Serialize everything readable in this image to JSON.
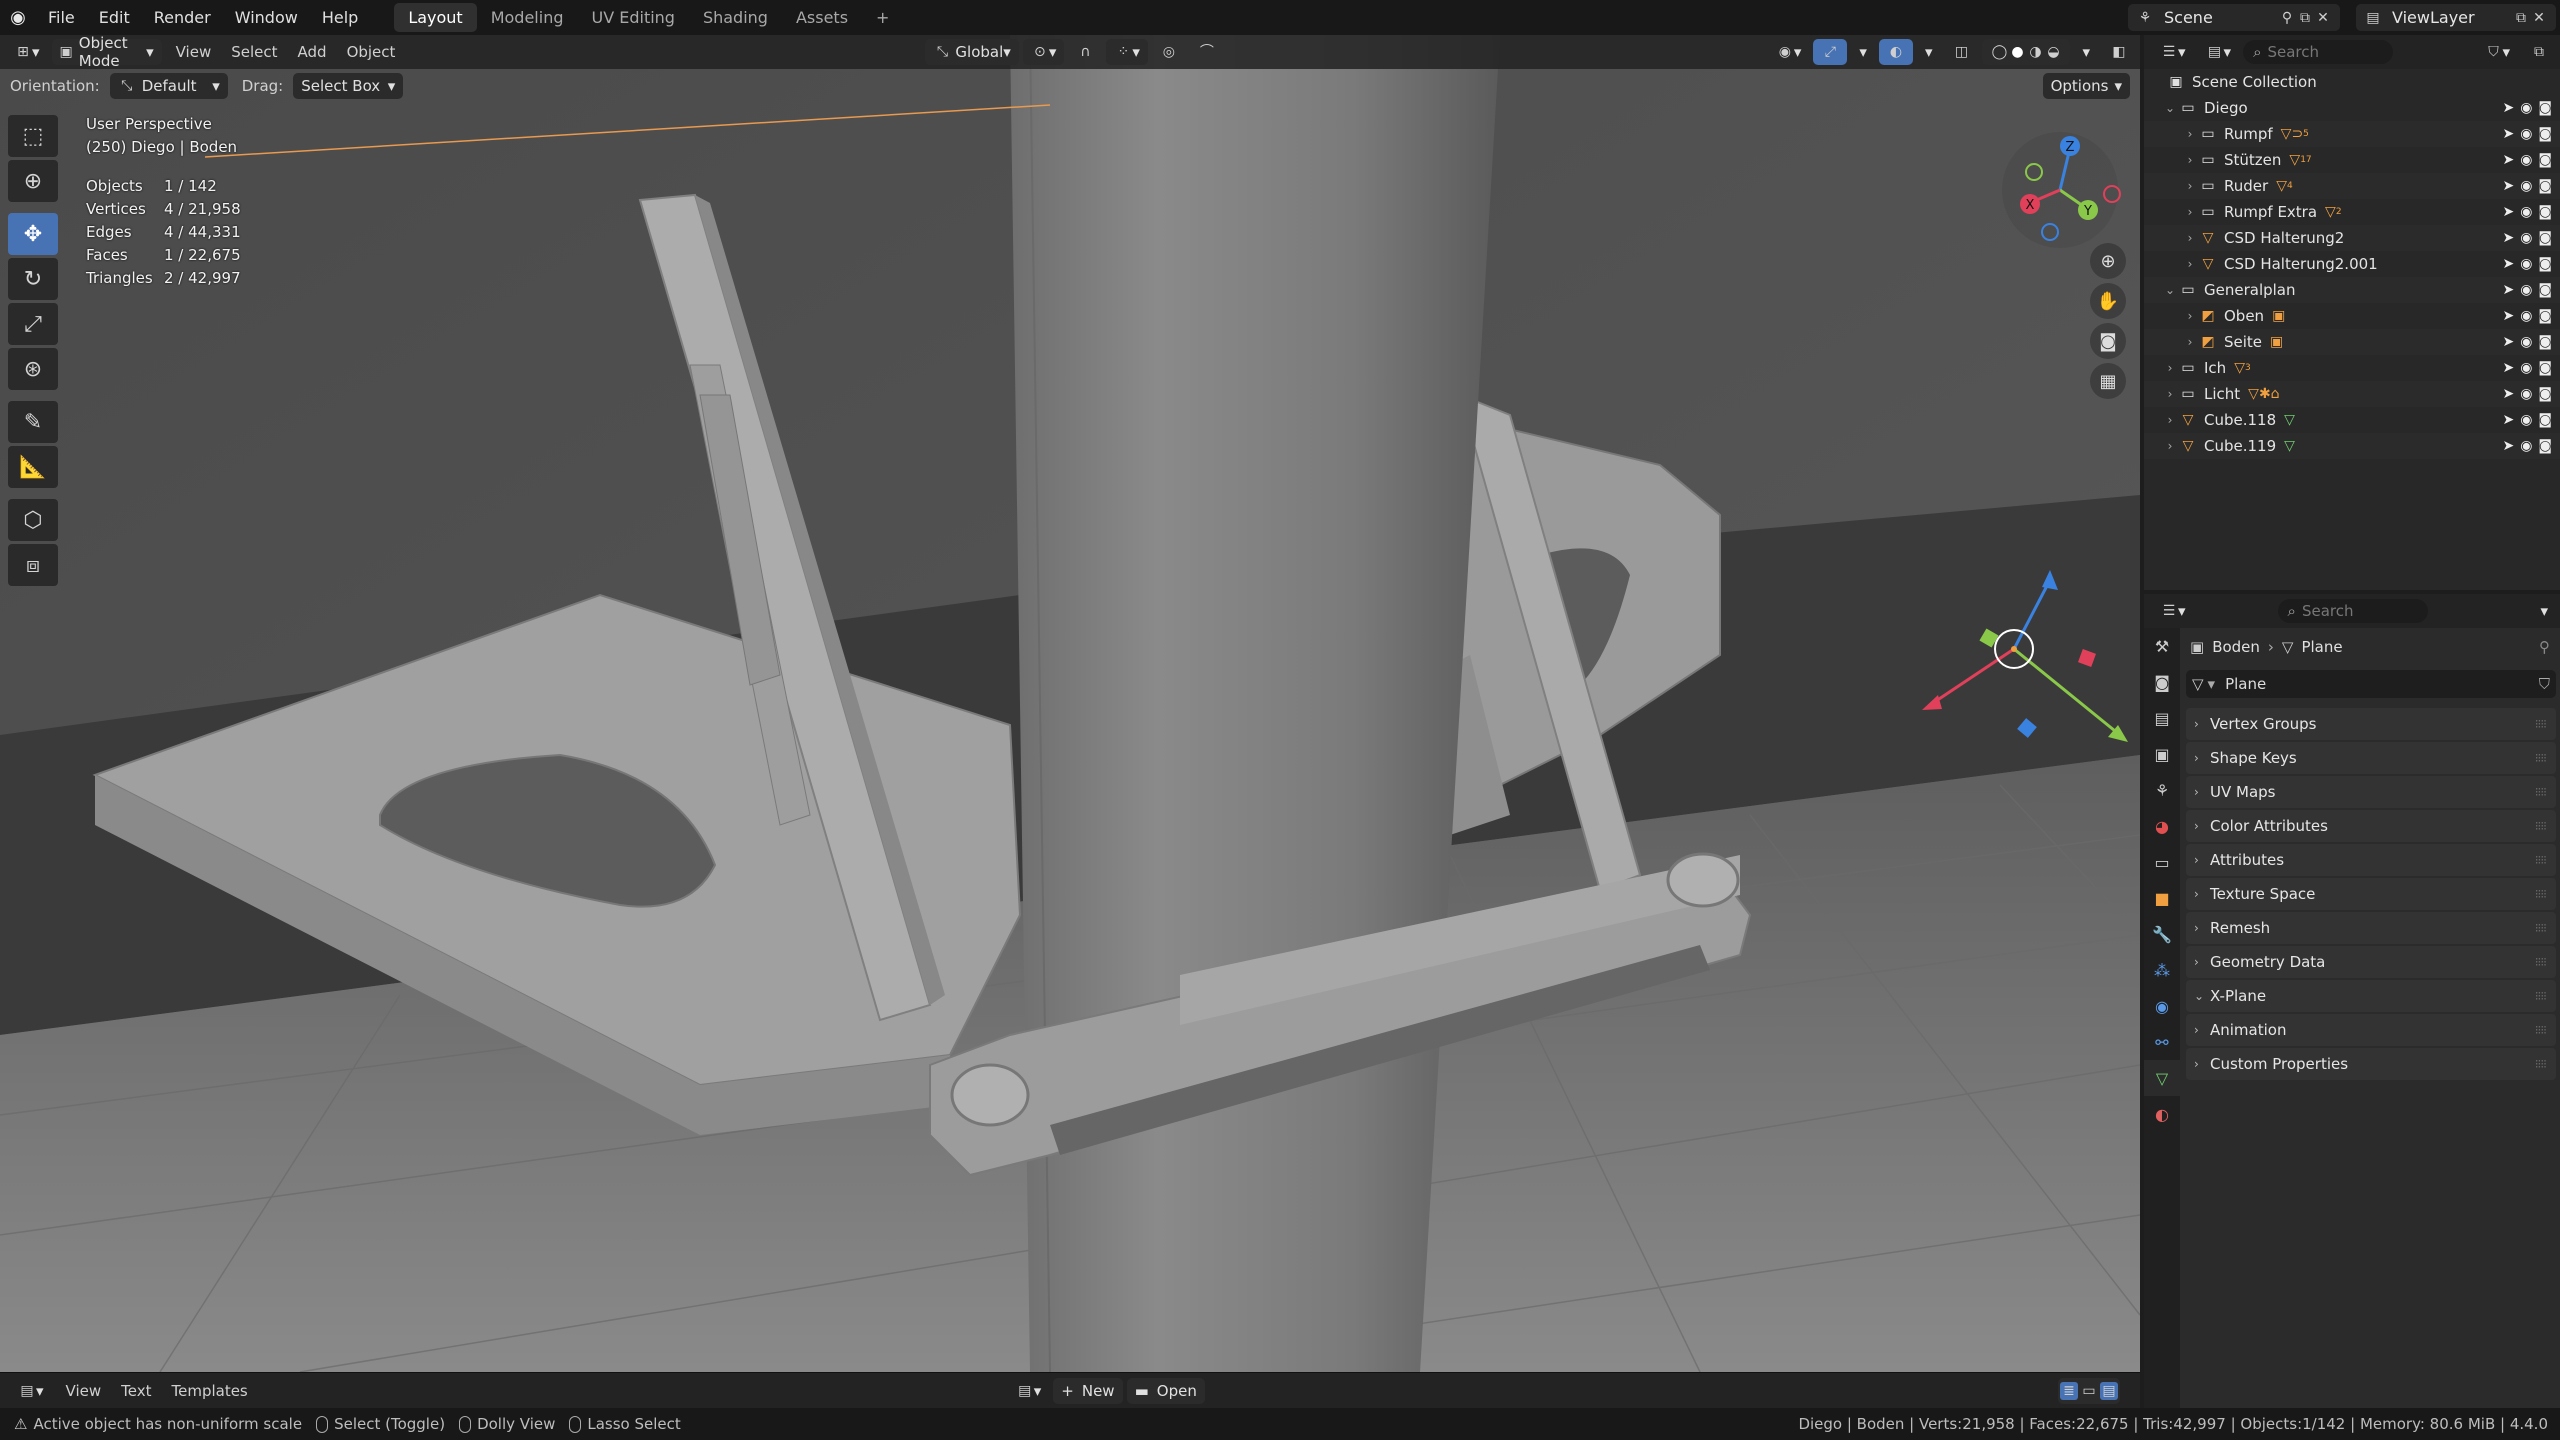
{
  "topbar": {
    "menus": [
      "File",
      "Edit",
      "Render",
      "Window",
      "Help"
    ],
    "workspaces": [
      "Layout",
      "Modeling",
      "UV Editing",
      "Shading",
      "Assets"
    ],
    "active_workspace": "Layout",
    "add_tab": "+",
    "scene_name": "Scene",
    "view_layer": "ViewLayer"
  },
  "viewport_header": {
    "mode": "Object Mode",
    "menus": [
      "View",
      "Select",
      "Add",
      "Object"
    ],
    "transform_orientation": "Global",
    "options_label": "Options",
    "orientation_label": "Orientation:",
    "orientation_value": "Default",
    "drag_label": "Drag:",
    "drag_value": "Select Box"
  },
  "overlay": {
    "view_name": "User Perspective",
    "context": "(250) Diego | Boden",
    "stats": [
      {
        "label": "Objects",
        "value": "1 / 142"
      },
      {
        "label": "Vertices",
        "value": "4 / 21,958"
      },
      {
        "label": "Edges",
        "value": "4 / 44,331"
      },
      {
        "label": "Faces",
        "value": "1 / 22,675"
      },
      {
        "label": "Triangles",
        "value": "2 / 42,997"
      }
    ]
  },
  "gizmo": {
    "x": "X",
    "y": "Y",
    "z": "Z"
  },
  "text_editor": {
    "menus": [
      "View",
      "Text",
      "Templates"
    ],
    "new_label": "New",
    "open_label": "Open"
  },
  "statusbar": {
    "warning": "Active object has non-uniform scale",
    "hint1": "Select (Toggle)",
    "hint2": "Dolly View",
    "hint3": "Lasso Select",
    "info": "Diego | Boden | Verts:21,958 | Faces:22,675 | Tris:42,997 | Objects:1/142 | Memory: 80.6 MiB | 4.4.0"
  },
  "outliner": {
    "search_placeholder": "Search",
    "root": "Scene Collection",
    "rows": [
      {
        "label": "Diego",
        "depth": 1,
        "type": "collection",
        "expanded": true,
        "badge": "",
        "badge_sub": ""
      },
      {
        "label": "Rumpf",
        "depth": 2,
        "type": "collection",
        "expanded": false,
        "badge": "▽⊃",
        "badge_sub": "5"
      },
      {
        "label": "Stützen",
        "depth": 2,
        "type": "collection",
        "expanded": false,
        "badge": "▽",
        "badge_sub": "17"
      },
      {
        "label": "Ruder",
        "depth": 2,
        "type": "collection",
        "expanded": false,
        "badge": "▽",
        "badge_sub": "4"
      },
      {
        "label": "Rumpf Extra",
        "depth": 2,
        "type": "collection",
        "expanded": false,
        "badge": "▽",
        "badge_sub": "2"
      },
      {
        "label": "CSD Halterung2",
        "depth": 2,
        "type": "mesh",
        "expanded": false,
        "badge": "",
        "badge_sub": ""
      },
      {
        "label": "CSD Halterung2.001",
        "depth": 2,
        "type": "mesh",
        "expanded": false,
        "badge": "",
        "badge_sub": ""
      },
      {
        "label": "Generalplan",
        "depth": 1,
        "type": "collection",
        "expanded": true,
        "badge": "",
        "badge_sub": ""
      },
      {
        "label": "Oben",
        "depth": 2,
        "type": "image",
        "expanded": false,
        "badge": "▣",
        "badge_sub": ""
      },
      {
        "label": "Seite",
        "depth": 2,
        "type": "image",
        "expanded": false,
        "badge": "▣",
        "badge_sub": ""
      },
      {
        "label": "Ich",
        "depth": 1,
        "type": "collection",
        "expanded": false,
        "badge": "▽",
        "badge_sub": "3"
      },
      {
        "label": "Licht",
        "depth": 1,
        "type": "collection",
        "expanded": false,
        "badge": "▽✱⌂",
        "badge_sub": ""
      },
      {
        "label": "Cube.118",
        "depth": 1,
        "type": "mesh",
        "expanded": false,
        "badge": "▽",
        "badge_sub": ""
      },
      {
        "label": "Cube.119",
        "depth": 1,
        "type": "mesh",
        "expanded": false,
        "badge": "▽",
        "badge_sub": ""
      }
    ]
  },
  "properties": {
    "search_placeholder": "Search",
    "breadcrumb_object": "Boden",
    "breadcrumb_data": "Plane",
    "datablock_name": "Plane",
    "panels": [
      {
        "label": "Vertex Groups",
        "expanded": false
      },
      {
        "label": "Shape Keys",
        "expanded": false
      },
      {
        "label": "UV Maps",
        "expanded": false
      },
      {
        "label": "Color Attributes",
        "expanded": false
      },
      {
        "label": "Attributes",
        "expanded": false
      },
      {
        "label": "Texture Space",
        "expanded": false
      },
      {
        "label": "Remesh",
        "expanded": false
      },
      {
        "label": "Geometry Data",
        "expanded": false
      },
      {
        "label": "X-Plane",
        "expanded": true
      },
      {
        "label": "Animation",
        "expanded": false
      },
      {
        "label": "Custom Properties",
        "expanded": false
      }
    ]
  },
  "colors": {
    "accent": "#4772b3",
    "axis_x": "#e0405a",
    "axis_y": "#8ac84a",
    "axis_z": "#3a82e0",
    "object_orange": "#f0a040"
  }
}
